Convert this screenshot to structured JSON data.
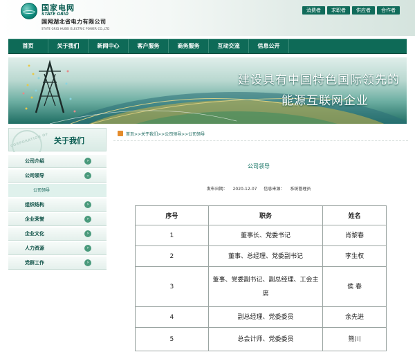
{
  "header": {
    "logo_cn": "国家电网",
    "logo_en": "STATE GRID",
    "company_cn": "国网湖北省电力有限公司",
    "company_en": "STATE GRID HUBEI ELECTRIC POWER CO.,LTD",
    "top_links": [
      "消费者",
      "求职者",
      "供应者",
      "合作者"
    ]
  },
  "nav": [
    "首页",
    "关于我们",
    "新闻中心",
    "客户服务",
    "商务服务",
    "互动交流",
    "信息公开"
  ],
  "banner": {
    "line1": "建设具有中国特色国际领先的",
    "line2": "能源互联网企业"
  },
  "sidebar": {
    "watermark": "CORPORATION OF",
    "title": "关于我们",
    "items": [
      {
        "label": "公司介绍"
      },
      {
        "label": "公司领导"
      },
      {
        "label": "公司领导",
        "sub": true
      },
      {
        "label": "组织结构"
      },
      {
        "label": "企业荣誉"
      },
      {
        "label": "企业文化"
      },
      {
        "label": "人力资源"
      },
      {
        "label": "党群工作"
      }
    ]
  },
  "breadcrumb": "首页>>关于我们>>公司领导>>公司领导",
  "article": {
    "title": "公司领导",
    "date_label": "发布日期：",
    "date": "2020-12-07",
    "source_label": "信息来源：",
    "source": "系统管理员"
  },
  "table": {
    "headers": [
      "序号",
      "职务",
      "姓名"
    ],
    "rows": [
      {
        "no": "1",
        "title": "董事长、党委书记",
        "name": "肖黎春"
      },
      {
        "no": "2",
        "title": "董事、总经理、党委副书记",
        "name": "李生权"
      },
      {
        "no": "3",
        "title": "董事、党委副书记、副总经理、工会主席",
        "name": "侯  春"
      },
      {
        "no": "4",
        "title": "副总经理、党委委员",
        "name": "余先进"
      },
      {
        "no": "5",
        "title": "总会计师、党委委员",
        "name": "熊川"
      }
    ]
  },
  "colors": {
    "brand_green": "#0e6a57",
    "accent_orange": "#e48b2b"
  }
}
